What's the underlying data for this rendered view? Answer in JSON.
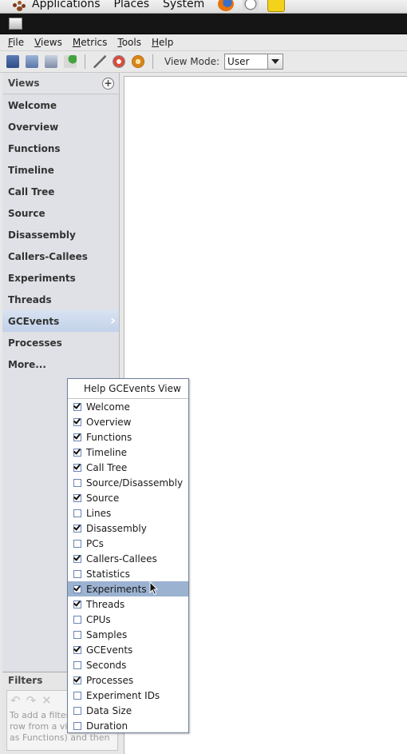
{
  "panel": {
    "menus": [
      "Applications",
      "Places",
      "System"
    ],
    "icons": [
      "foot-icon",
      "firefox-icon",
      "clock-icon",
      "notes-icon"
    ]
  },
  "menubar": {
    "items": [
      {
        "label": "File",
        "underline": "F",
        "rest": "ile"
      },
      {
        "label": "Views",
        "underline": "V",
        "rest": "iews"
      },
      {
        "label": "Metrics",
        "underline": "M",
        "rest": "etrics"
      },
      {
        "label": "Tools",
        "underline": "T",
        "rest": "ools"
      },
      {
        "label": "Help",
        "underline": "H",
        "rest": "elp"
      }
    ]
  },
  "toolbar": {
    "view_mode_label": "View Mode:",
    "view_mode_value": "User"
  },
  "views": {
    "title": "Views",
    "items": [
      "Welcome",
      "Overview",
      "Functions",
      "Timeline",
      "Call Tree",
      "Source",
      "Disassembly",
      "Callers-Callees",
      "Experiments",
      "Threads",
      "GCEvents",
      "Processes",
      "More..."
    ],
    "active": "GCEvents"
  },
  "filters": {
    "title": "Filters",
    "help_lines": [
      "To add a filter,",
      "row from a vi...",
      "as Functions) and then"
    ]
  },
  "popup": {
    "header": "Help GCEvents View",
    "items": [
      {
        "label": "Welcome",
        "checked": true
      },
      {
        "label": "Overview",
        "checked": true
      },
      {
        "label": "Functions",
        "checked": true
      },
      {
        "label": "Timeline",
        "checked": true
      },
      {
        "label": "Call Tree",
        "checked": true
      },
      {
        "label": "Source/Disassembly",
        "checked": false
      },
      {
        "label": "Source",
        "checked": true
      },
      {
        "label": "Lines",
        "checked": false
      },
      {
        "label": "Disassembly",
        "checked": true
      },
      {
        "label": "PCs",
        "checked": false
      },
      {
        "label": "Callers-Callees",
        "checked": true
      },
      {
        "label": "Statistics",
        "checked": false
      },
      {
        "label": "Experiments",
        "checked": true,
        "highlighted": true
      },
      {
        "label": "Threads",
        "checked": true
      },
      {
        "label": "CPUs",
        "checked": false
      },
      {
        "label": "Samples",
        "checked": false
      },
      {
        "label": "GCEvents",
        "checked": true
      },
      {
        "label": "Seconds",
        "checked": false
      },
      {
        "label": "Processes",
        "checked": true
      },
      {
        "label": "Experiment IDs",
        "checked": false
      },
      {
        "label": "Data Size",
        "checked": false
      },
      {
        "label": "Duration",
        "checked": false
      }
    ]
  }
}
